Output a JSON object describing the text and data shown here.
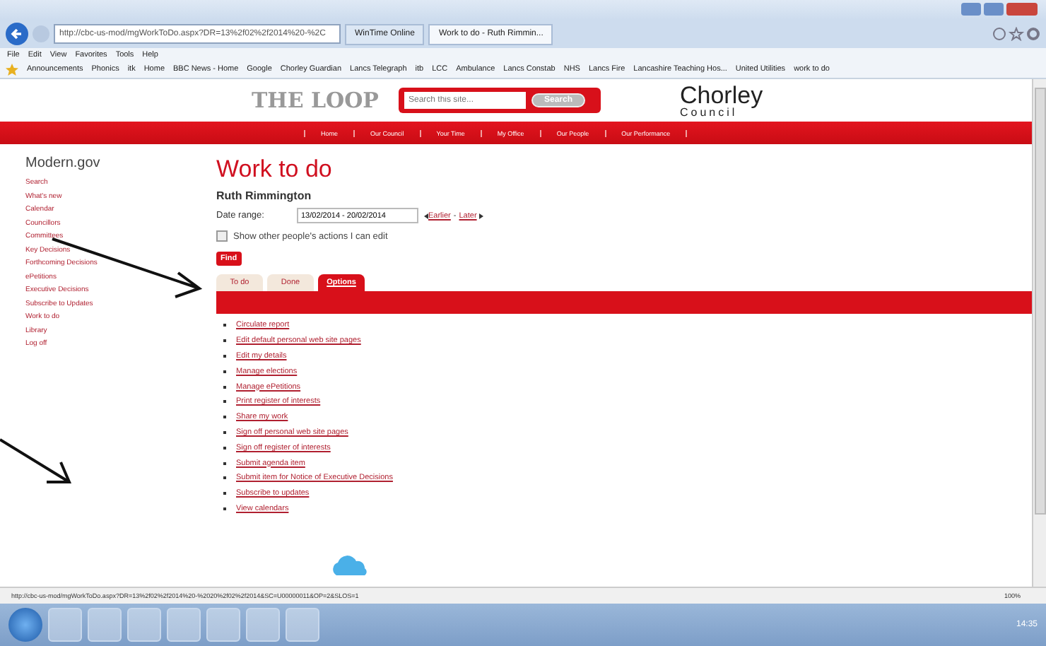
{
  "browser": {
    "address": "http://cbc-us-mod/mgWorkToDo.aspx?DR=13%2f02%2f2014%20-%2C",
    "tabs": [
      {
        "label": "WinTime Online",
        "selected": false
      },
      {
        "label": "Work to do - Ruth Rimmin...",
        "selected": true
      }
    ],
    "menu": [
      "File",
      "Edit",
      "View",
      "Favorites",
      "Tools",
      "Help"
    ],
    "favorites": [
      "Announcements",
      "Phonics",
      "itk",
      "Home",
      "BBC News - Home",
      "Google",
      "Chorley Guardian",
      "Lancs Telegraph",
      "itb",
      "LCC",
      "Ambulance",
      "Lancs Constab",
      "NHS",
      "Lancs Fire",
      "Lancashire Teaching Hos...",
      "United Utilities",
      "work to do"
    ]
  },
  "site": {
    "logo": "THE LOOP",
    "search_placeholder": "Search this site...",
    "search_button": "Search",
    "council_logo": "Chorley",
    "council_sub": "Council",
    "nav": [
      "Home",
      "Our Council",
      "Your Time",
      "My Office",
      "Our People",
      "Our Performance"
    ]
  },
  "sidebar": {
    "title": "Modern.gov",
    "items": [
      "Search",
      "What's new",
      "Calendar",
      "Councillors",
      "Committees",
      "Key Decisions",
      "Forthcoming Decisions",
      "ePetitions",
      "Executive Decisions",
      "Subscribe to Updates",
      "Work to do",
      "Library",
      "Log off"
    ]
  },
  "main": {
    "title": "Work to do",
    "person": "Ruth Rimmington",
    "date_label": "Date range:",
    "date_value": "13/02/2014 - 20/02/2014",
    "earlier": "Earlier",
    "separator": "-",
    "later": "Later",
    "show_others": {
      "label": "Show other people's actions I can edit",
      "checked": false
    },
    "find": "Find",
    "tabs": [
      {
        "label": "To do",
        "selected": false
      },
      {
        "label": "Done",
        "selected": false
      },
      {
        "label": "Options",
        "selected": true
      }
    ],
    "options": [
      "Circulate report",
      "Edit default personal web site pages",
      "Edit my details",
      "Manage elections",
      "Manage ePetitions",
      "Print register of interests",
      "Share my work",
      "Sign off personal web site pages",
      "Sign off register of interests",
      "Submit agenda item",
      "Submit item for Notice of Executive Decisions",
      "Subscribe to updates",
      "View calendars"
    ]
  },
  "status_bar": {
    "url": "http://cbc-us-mod/mgWorkToDo.aspx?DR=13%2f02%2f2014%20-%2020%2f02%2f2014&SC=U00000011&OP=2&SLOS=1",
    "zoom": "100%"
  },
  "taskbar": {
    "clock": "14:35"
  }
}
